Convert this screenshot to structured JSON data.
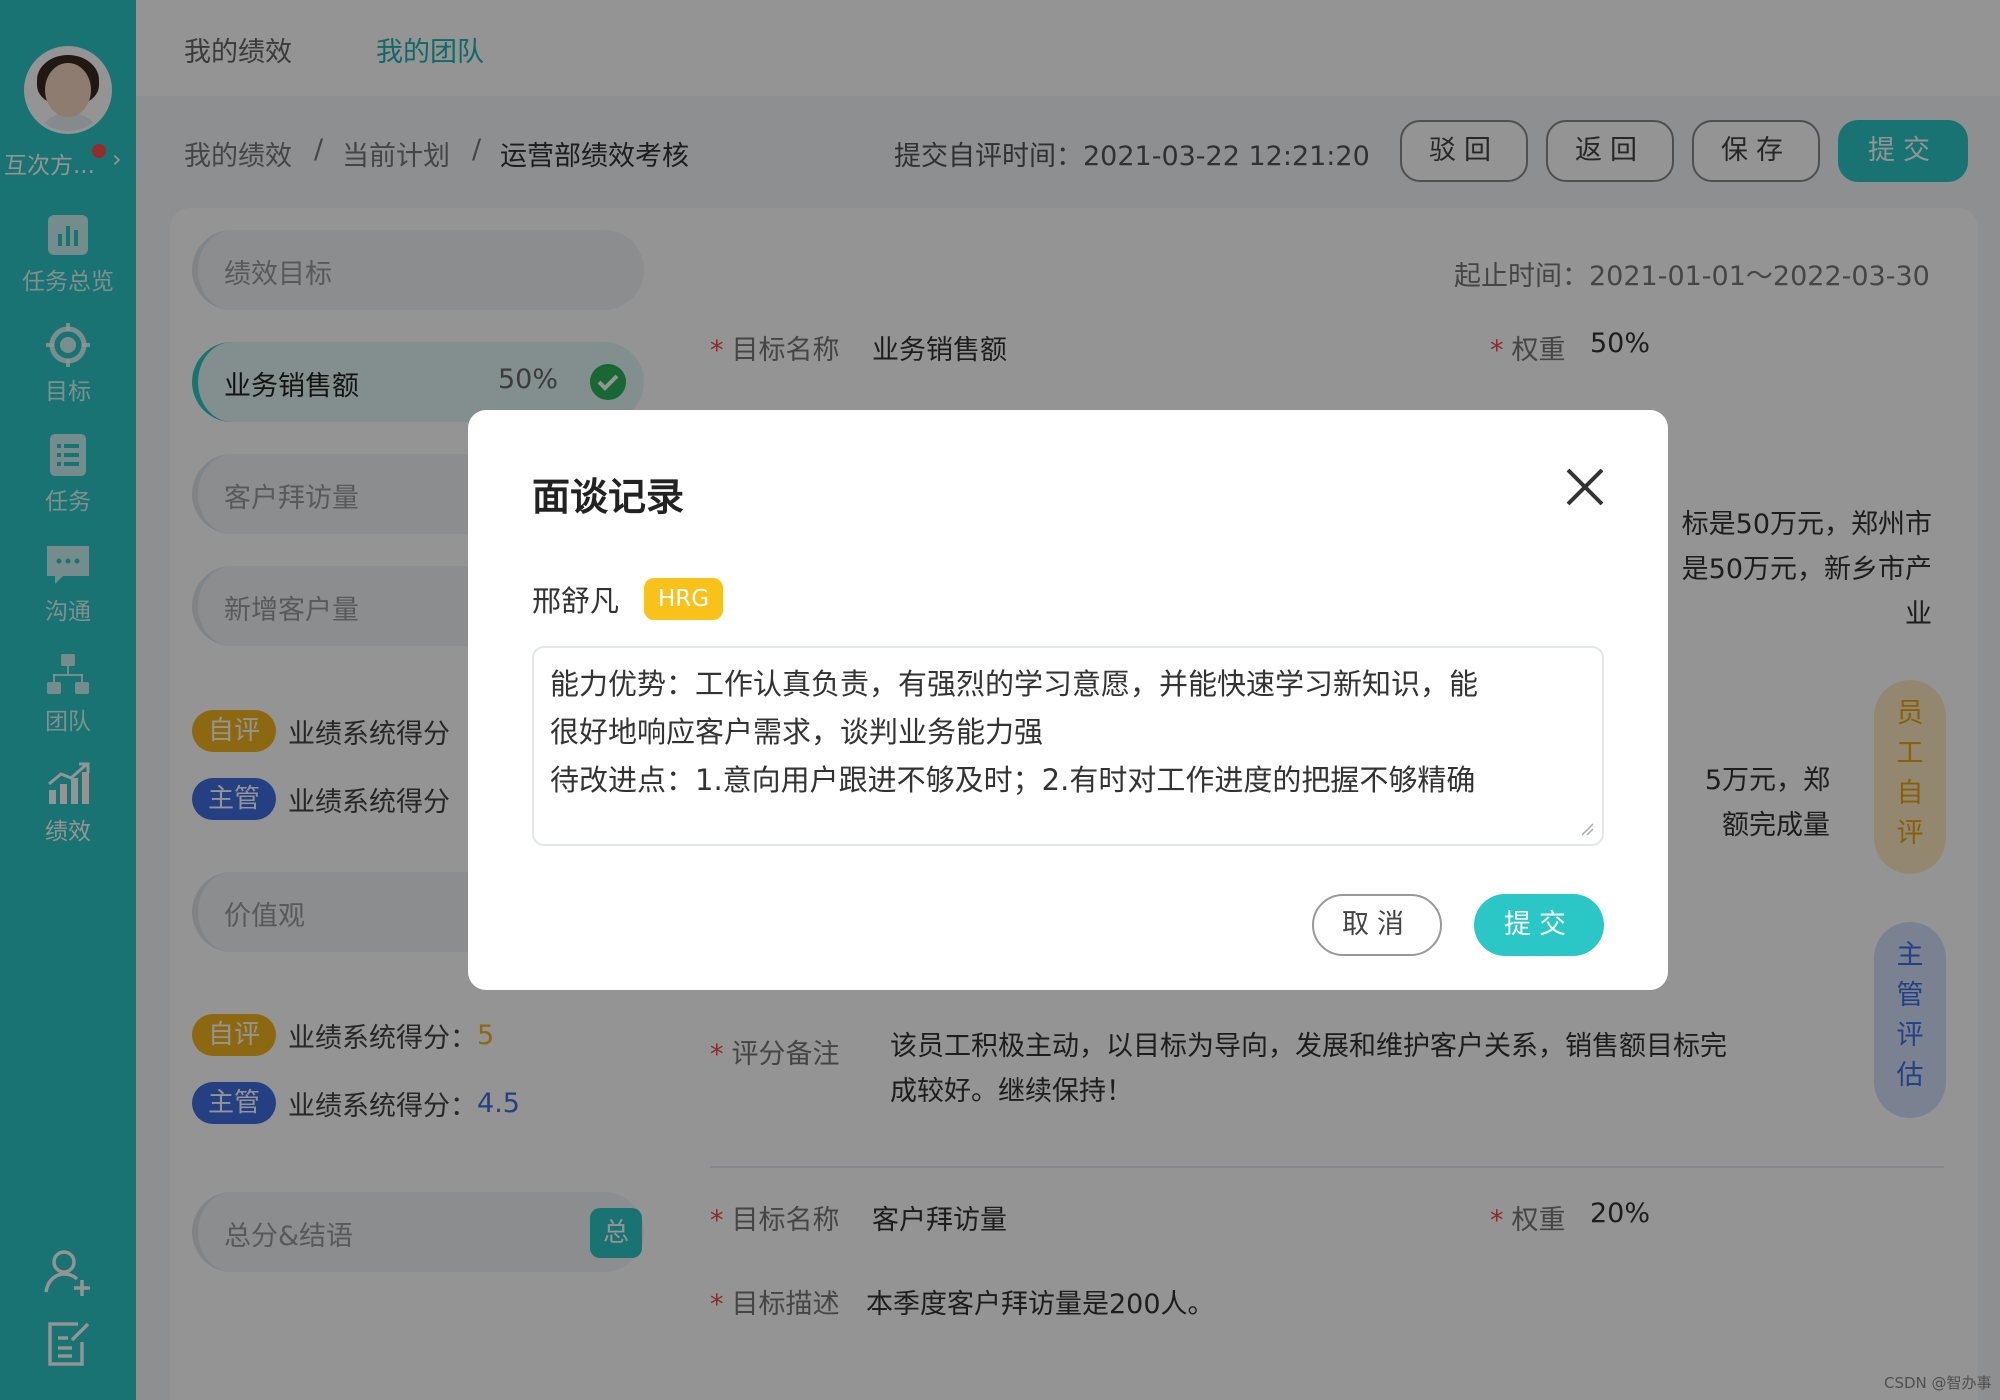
{
  "user": {
    "name": "互次方..."
  },
  "sidebar": {
    "items": [
      {
        "label": "任务总览",
        "icon": "bar-chart-icon"
      },
      {
        "label": "目标",
        "icon": "target-icon"
      },
      {
        "label": "任务",
        "icon": "task-list-icon"
      },
      {
        "label": "沟通",
        "icon": "chat-icon"
      },
      {
        "label": "团队",
        "icon": "org-chart-icon"
      },
      {
        "label": "绩效",
        "icon": "growth-chart-icon",
        "active": true
      }
    ],
    "bottom_icons": [
      "add-user-icon",
      "edit-note-icon"
    ]
  },
  "top_tabs": [
    {
      "label": "我的绩效",
      "active": false
    },
    {
      "label": "我的团队",
      "active": true
    }
  ],
  "breadcrumb": [
    "我的绩效",
    "当前计划",
    "运营部绩效考核"
  ],
  "breadcrumb_sep": "/",
  "submit_time": "提交自评时间：2021-03-22 12:21:20",
  "actions": {
    "reject": "驳回",
    "back": "返回",
    "save": "保存",
    "submit": "提交"
  },
  "left_panel": {
    "section1_title": "绩效目标",
    "goals": [
      {
        "label": "业务销售额",
        "pct": "50%",
        "done": true
      },
      {
        "label": "客户拜访量"
      },
      {
        "label": "新增客户量"
      }
    ],
    "score_block1": {
      "self_tag": "自评",
      "self_label": "业绩系统得分",
      "mgr_tag": "主管",
      "mgr_label": "业绩系统得分"
    },
    "section2_title": "价值观",
    "score_block2": {
      "self_tag": "自评",
      "self_label": "业绩系统得分：",
      "self_value": "5",
      "mgr_tag": "主管",
      "mgr_label": "业绩系统得分：",
      "mgr_value": "4.5"
    },
    "summary_title": "总分&结语",
    "summary_badge": "总"
  },
  "detail": {
    "range": "起止时间：2021-01-01～2022-03-30",
    "goal1": {
      "name_label": "目标名称",
      "name_value": "业务销售额",
      "weight_label": "权重",
      "weight_value": "50%"
    },
    "partial1_line1": "标是50万元，郑州市",
    "partial1_line2": "是50万元，新乡市产业",
    "partial2_line1": "5万元，郑",
    "partial2_line2": "额完成量",
    "remark_label": "评分备注",
    "remark_line1": "该员工积极主动，以目标为导向，发展和维护客户关系，销售额目标完",
    "remark_line2": "成较好。继续保持！",
    "goal2": {
      "name_label": "目标名称",
      "name_value": "客户拜访量",
      "weight_label": "权重",
      "weight_value": "20%"
    },
    "goal2_desc_label": "目标描述",
    "goal2_desc_value": "本季度客户拜访量是200人。",
    "vtab_self": [
      "员",
      "工",
      "自",
      "评"
    ],
    "vtab_mgr": [
      "主",
      "管",
      "评",
      "估"
    ]
  },
  "modal": {
    "title": "面谈记录",
    "person_name": "邢舒凡",
    "person_tag": "HRG",
    "text_line1": "能力优势：工作认真负责，有强烈的学习意愿，并能快速学习新知识，能",
    "text_line2": "很好地响应客户需求，谈判业务能力强",
    "text_line3": "待改进点：1.意向用户跟进不够及时；2.有时对工作进度的把握不够精确",
    "cancel": "取消",
    "submit": "提交"
  },
  "watermark": "CSDN @智办事",
  "colors": {
    "accent": "#2bc7c7",
    "self": "#f2b51e",
    "mgr": "#3e6fe1",
    "required": "#e84a4a"
  }
}
